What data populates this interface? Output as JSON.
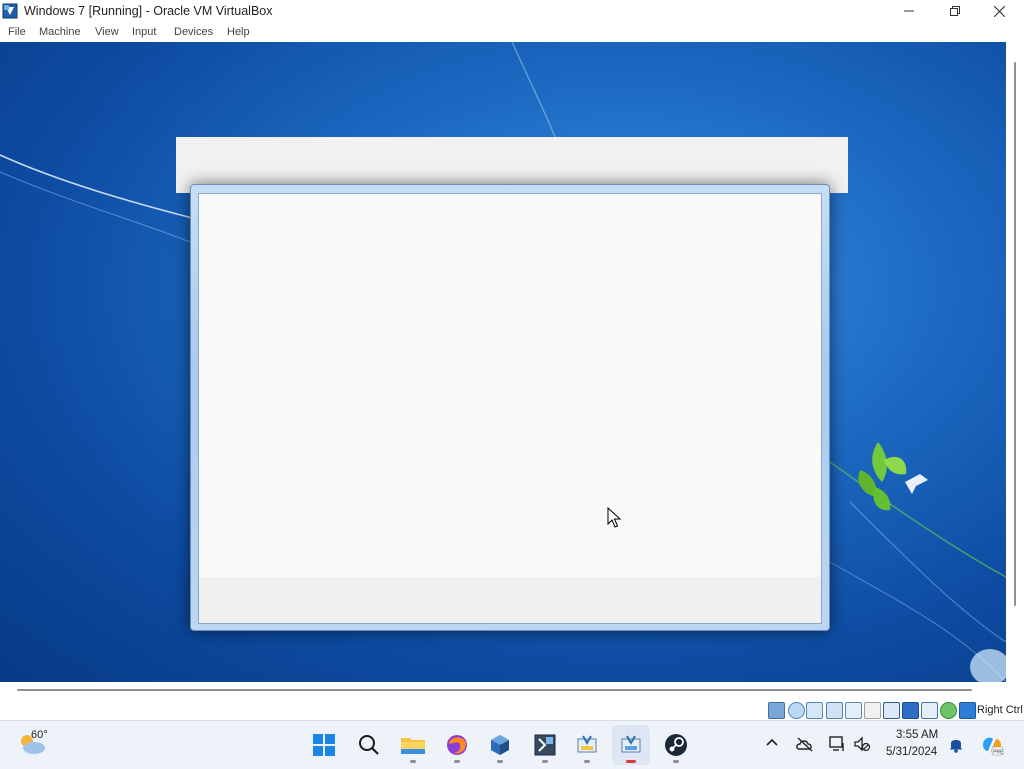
{
  "window": {
    "title": "Windows 7 [Running] - Oracle VM VirtualBox",
    "minimize_icon": "minimize-icon",
    "maximize_icon": "restore-icon",
    "close_icon": "close-icon"
  },
  "menu": {
    "items": [
      {
        "label": "File"
      },
      {
        "label": "Machine"
      },
      {
        "label": "View"
      },
      {
        "label": "Input"
      },
      {
        "label": "Devices"
      },
      {
        "label": "Help"
      }
    ]
  },
  "statusbar": {
    "icons": [
      "hard-disk-icon",
      "optical-drive-icon",
      "audio-icon",
      "network-icon",
      "usb-icon",
      "shared-folders-icon",
      "display-icon",
      "recording-icon",
      "virtualization-icon",
      "mouse-integration-icon",
      "guest-additions-icon",
      "arrow-down-icon"
    ],
    "host_key": "Right Ctrl"
  },
  "taskbar": {
    "weather_temp": "60°",
    "apps": [
      "start-icon",
      "search-icon",
      "file-explorer-icon",
      "firefox-icon",
      "virtualbox-icon",
      "terminal-icon",
      "snipping-tool-icon",
      "virtualbox-vm-icon",
      "steam-icon"
    ],
    "clock_time": "3:55 AM",
    "clock_date": "5/31/2024"
  },
  "colors": {
    "desktop_blue": "#1d6bc4",
    "taskbar_bg": "#eef2f9",
    "dialog_border": "#a9cbee"
  }
}
